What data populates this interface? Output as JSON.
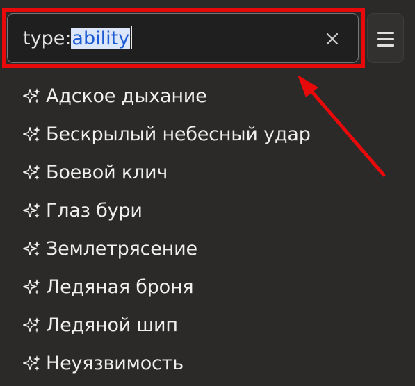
{
  "search": {
    "prefix": "type:",
    "selected_query": "ability"
  },
  "toolbar": {
    "clear_icon": "close-icon",
    "menu_icon": "hamburger-menu-icon"
  },
  "results": {
    "item_icon": "sparkles-icon",
    "items": [
      {
        "label": "Адское дыхание"
      },
      {
        "label": "Бескрылый небесный удар"
      },
      {
        "label": "Боевой клич"
      },
      {
        "label": "Глаз бури"
      },
      {
        "label": "Землетрясение"
      },
      {
        "label": "Ледяная броня"
      },
      {
        "label": "Ледяной шип"
      },
      {
        "label": "Неуязвимость"
      }
    ]
  },
  "annotation": {
    "highlight_color": "#e80a0a"
  },
  "theme": {
    "background": "#2b2a29",
    "selection_bg": "#dbe6fb",
    "selection_text": "#1c5bd4"
  }
}
